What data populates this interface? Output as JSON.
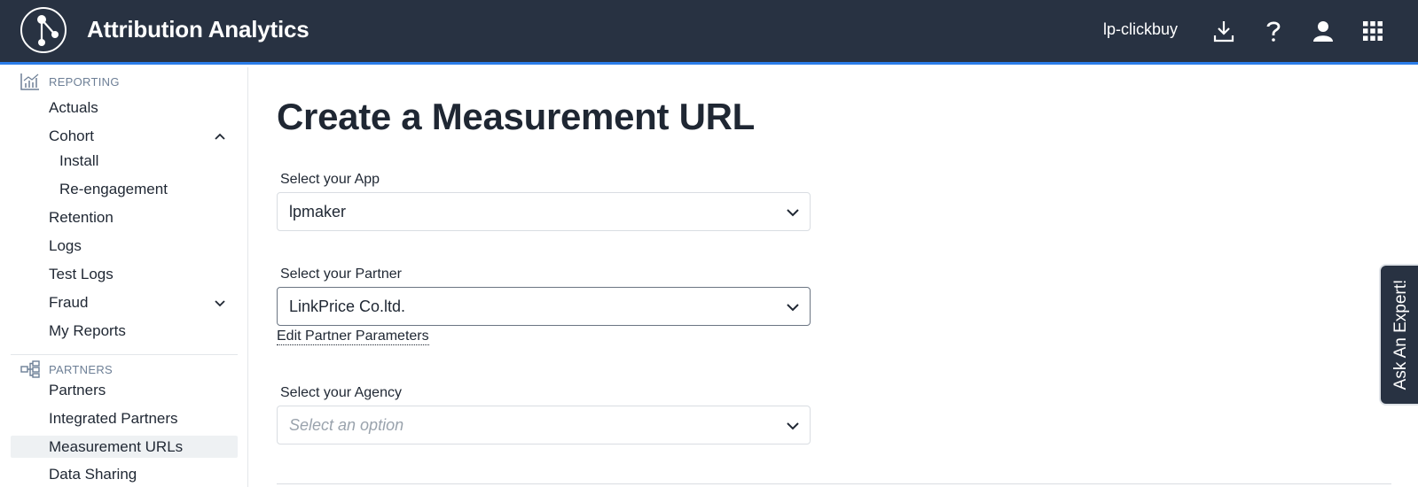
{
  "header": {
    "app_title": "Attribution Analytics",
    "account_name": "lp-clickbuy",
    "icons": [
      "download-icon",
      "help-icon",
      "user-icon",
      "apps-grid-icon"
    ]
  },
  "sidebar": {
    "reporting_section": "REPORTING",
    "reporting_items": {
      "actuals": "Actuals",
      "cohort": "Cohort",
      "install": "Install",
      "reengagement": "Re-engagement",
      "retention": "Retention",
      "logs": "Logs",
      "test_logs": "Test Logs",
      "fraud": "Fraud",
      "my_reports": "My Reports"
    },
    "partners_section": "PARTNERS",
    "partners_items": {
      "partners": "Partners",
      "integrated_partners": "Integrated Partners",
      "measurement_urls": "Measurement URLs",
      "data_sharing": "Data Sharing"
    },
    "active_item": "Measurement URLs"
  },
  "main": {
    "title": "Create a Measurement URL",
    "app_label": "Select your App",
    "app_value": "lpmaker",
    "partner_label": "Select your Partner",
    "partner_value": "LinkPrice Co.ltd.",
    "edit_partner_link": "Edit Partner Parameters",
    "agency_label": "Select your Agency",
    "agency_placeholder": "Select an option"
  },
  "expert_tab": {
    "label": "Ask An Expert!"
  },
  "colors": {
    "header_bg": "#283242",
    "accent": "#2b7de9",
    "text": "#1f2733",
    "muted": "#6d7f96"
  }
}
